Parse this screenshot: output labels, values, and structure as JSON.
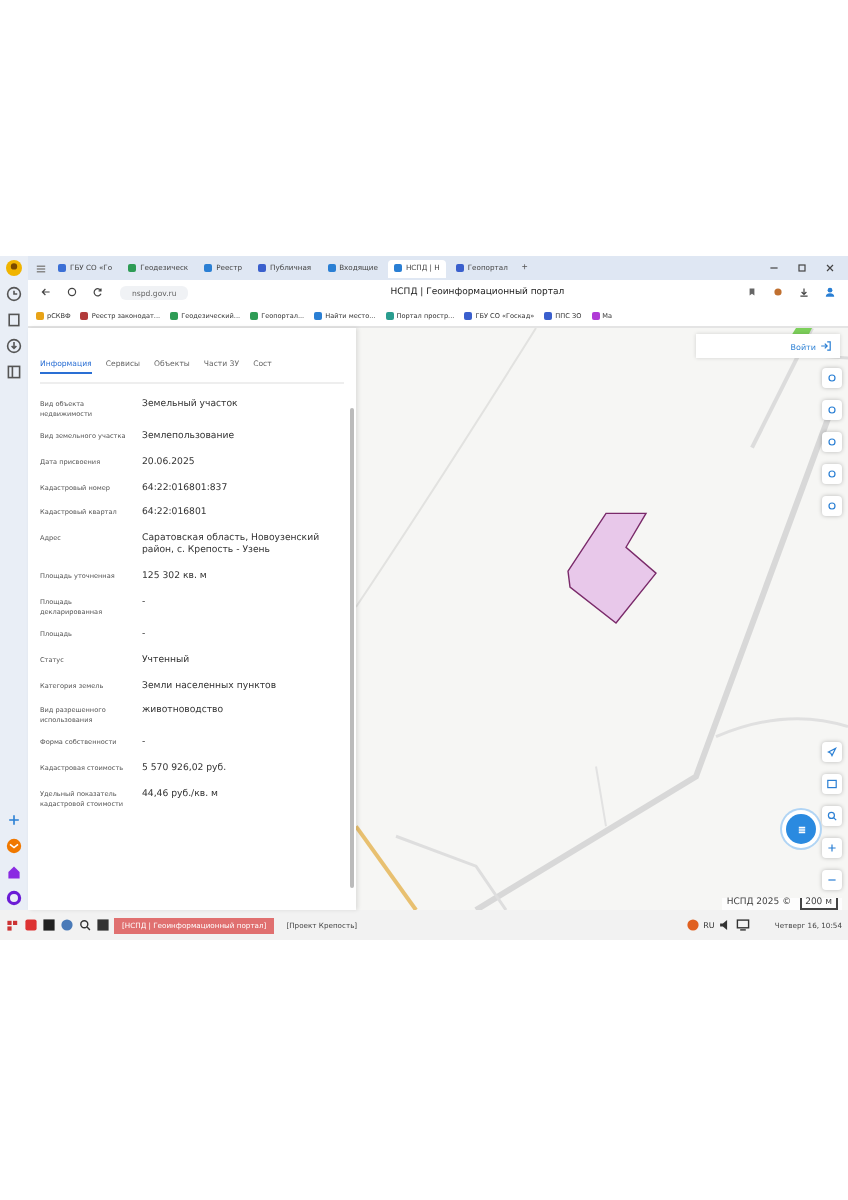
{
  "browser": {
    "tabs": [
      {
        "label": "ГБУ СО «Го",
        "color": "#3b6fd6",
        "selected": false
      },
      {
        "label": "Геодезическ",
        "color": "#2e9c55",
        "selected": false
      },
      {
        "label": "Реестр",
        "color": "#2a7fd4",
        "selected": false
      },
      {
        "label": "Публичная",
        "color": "#3a5fcd",
        "selected": false
      },
      {
        "label": "Входящие",
        "color": "#2a7fd4",
        "selected": false
      },
      {
        "label": "НСПД | Н",
        "color": "#2a7fd4",
        "selected": true
      },
      {
        "label": "Геопортал",
        "color": "#3a5fcd",
        "selected": false
      }
    ],
    "new_tab": "+",
    "url": "nspd.gov.ru",
    "page_title": "НСПД | Геоинформационный портал",
    "bookmarks": [
      {
        "label": "рСКВФ",
        "color": "#e8a317"
      },
      {
        "label": "Реестр законодат...",
        "color": "#b23b3b"
      },
      {
        "label": "Геодезический...",
        "color": "#2e9c55"
      },
      {
        "label": "Геопортал...",
        "color": "#2e9c55"
      },
      {
        "label": "Найти место...",
        "color": "#2a7fd4"
      },
      {
        "label": "Портал простр...",
        "color": "#2a9d8f"
      },
      {
        "label": "ГБУ СО «Госкад»",
        "color": "#3a5fcd"
      },
      {
        "label": "ППС ЗО",
        "color": "#3a5fcd"
      },
      {
        "label": "Ма",
        "color": "#b03ad6"
      }
    ]
  },
  "panel": {
    "tabs": [
      {
        "label": "Информация",
        "selected": true
      },
      {
        "label": "Сервисы",
        "selected": false
      },
      {
        "label": "Объекты",
        "selected": false
      },
      {
        "label": "Части ЗУ",
        "selected": false
      },
      {
        "label": "Сост",
        "selected": false
      }
    ],
    "rows": [
      {
        "label": "Вид объекта недвижимости",
        "value": "Земельный участок"
      },
      {
        "label": "Вид земельного участка",
        "value": "Землепользование"
      },
      {
        "label": "Дата присвоения",
        "value": "20.06.2025"
      },
      {
        "label": "Кадастровый номер",
        "value": "64:22:016801:837"
      },
      {
        "label": "Кадастровый квартал",
        "value": "64:22:016801"
      },
      {
        "label": "Адрес",
        "value": "Саратовская область, Новоузенский район, с. Крепость - Узень"
      },
      {
        "label": "Площадь уточненная",
        "value": "125 302 кв. м"
      },
      {
        "label": "Площадь декларированная",
        "value": "-"
      },
      {
        "label": "Площадь",
        "value": "-"
      },
      {
        "label": "Статус",
        "value": "Учтенный"
      },
      {
        "label": "Категория земель",
        "value": "Земли населенных пунктов"
      },
      {
        "label": "Вид разрешенного использования",
        "value": "животноводство"
      },
      {
        "label": "Форма собственности",
        "value": "-"
      },
      {
        "label": "Кадастровая стоимость",
        "value": "5 570 926,02 руб."
      },
      {
        "label": "Удельный показатель кадастровой стоимости",
        "value": "44,46 руб./кв. м"
      }
    ]
  },
  "map": {
    "kind": "picture",
    "login": "Войти",
    "attribution": "НСПД 2025 ©",
    "scale": "200 м"
  },
  "taskbar": {
    "windows": [
      {
        "label": "[НСПД | Геоинформационный портал]",
        "selected": true
      },
      {
        "label": "[Проект Крепость]",
        "selected": false
      }
    ],
    "language": "RU",
    "clock": "Четверг 16, 10:54"
  }
}
